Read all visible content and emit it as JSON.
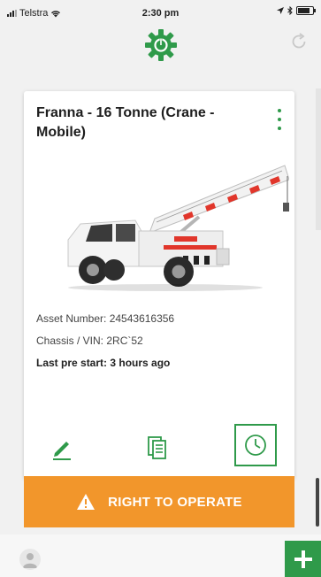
{
  "status_bar": {
    "carrier": "Telstra",
    "time": "2:30 pm",
    "battery_level": 0.8
  },
  "header": {
    "logo_icon": "gear-power-logo-icon",
    "refresh_icon": "refresh-icon"
  },
  "asset_card": {
    "title": "Franna - 16 Tonne (Crane - Mobile)",
    "menu_icon": "more-vertical-icon",
    "image": "mobile-crane-photo",
    "asset_number": "Asset Number: 24543616356",
    "chassis_vin": "Chassis / VIN: 2RC`52",
    "last_prestart": "Last pre start: 3 hours ago",
    "actions": [
      {
        "icon": "pencil-icon"
      },
      {
        "icon": "documents-icon"
      },
      {
        "icon": "clock-history-icon"
      }
    ]
  },
  "right_to_operate": {
    "label": "RIGHT TO OPERATE",
    "icon": "warning-icon"
  },
  "bottom_bar": {
    "avatar_icon": "user-avatar-icon",
    "add_icon": "plus-icon"
  },
  "colors": {
    "brand_green": "#2f9a4a",
    "accent_orange": "#f2962b"
  }
}
